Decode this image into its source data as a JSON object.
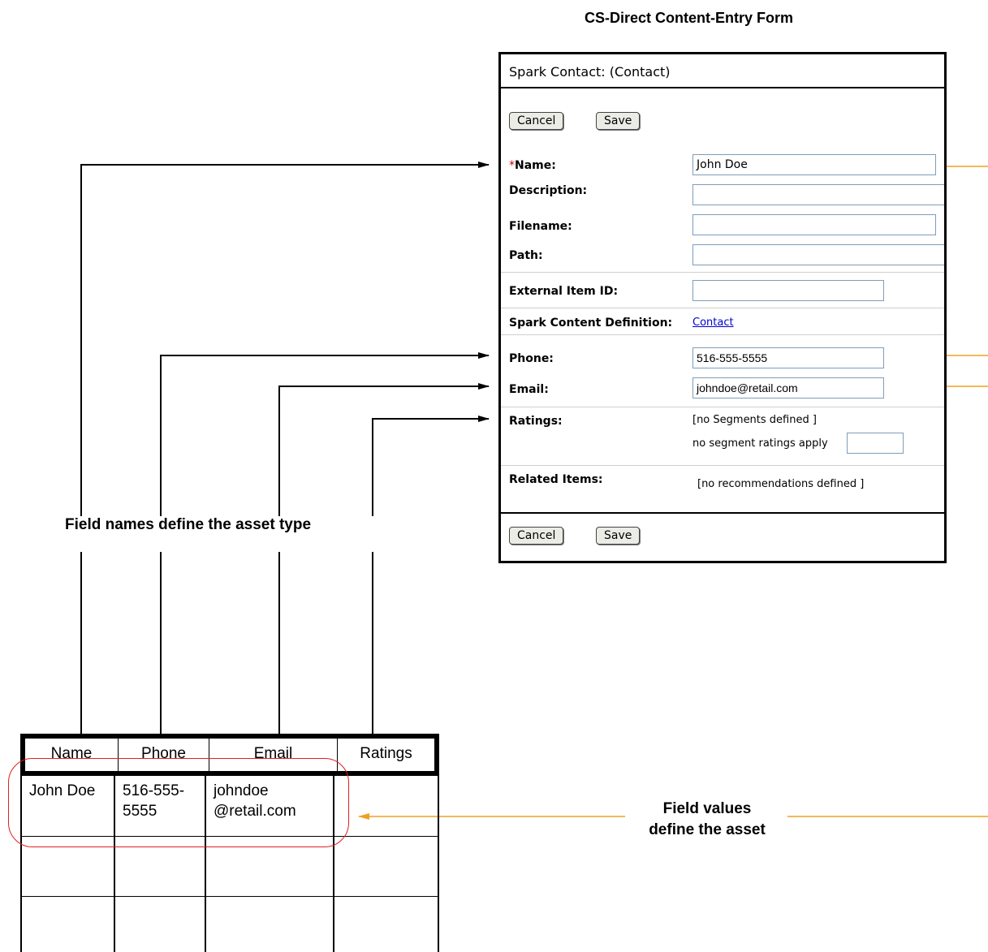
{
  "form_heading": "CS-Direct Content-Entry Form",
  "form": {
    "title": "Spark Contact: (Contact)",
    "cancel_label": "Cancel",
    "save_label": "Save",
    "required_mark": "*",
    "fields": {
      "name_label": "Name:",
      "name_value": "John Doe",
      "description_label": "Description:",
      "filename_label": "Filename:",
      "path_label": "Path:",
      "external_id_label": "External Item ID:",
      "definition_label": "Spark Content Definition:",
      "definition_link": "Contact",
      "phone_label": "Phone:",
      "phone_value": "516-555-5555",
      "email_label": "Email:",
      "email_value": "johndoe@retail.com",
      "ratings_label": "Ratings:",
      "ratings_note": "[no Segments defined ]",
      "segment_note": "no segment ratings apply",
      "related_label": "Related Items:",
      "related_note": "[no recommendations defined ]"
    }
  },
  "captions": {
    "field_names": "Field names define the asset type",
    "field_values_line1": "Field values",
    "field_values_line2": "define the asset"
  },
  "table": {
    "headers": [
      "Name",
      "Phone",
      "Email",
      "Ratings"
    ],
    "row1": {
      "name": "John Doe",
      "phone_1": "516-555-",
      "phone_2": "5555",
      "email_1": "johndoe",
      "email_2": "@retail.com",
      "ratings": ""
    }
  },
  "colors": {
    "arrow_black": "#000000",
    "arrow_orange": "#f0a020",
    "highlight_oval": "#e02020",
    "required_red": "#d00000",
    "link_blue": "#0000cc"
  }
}
